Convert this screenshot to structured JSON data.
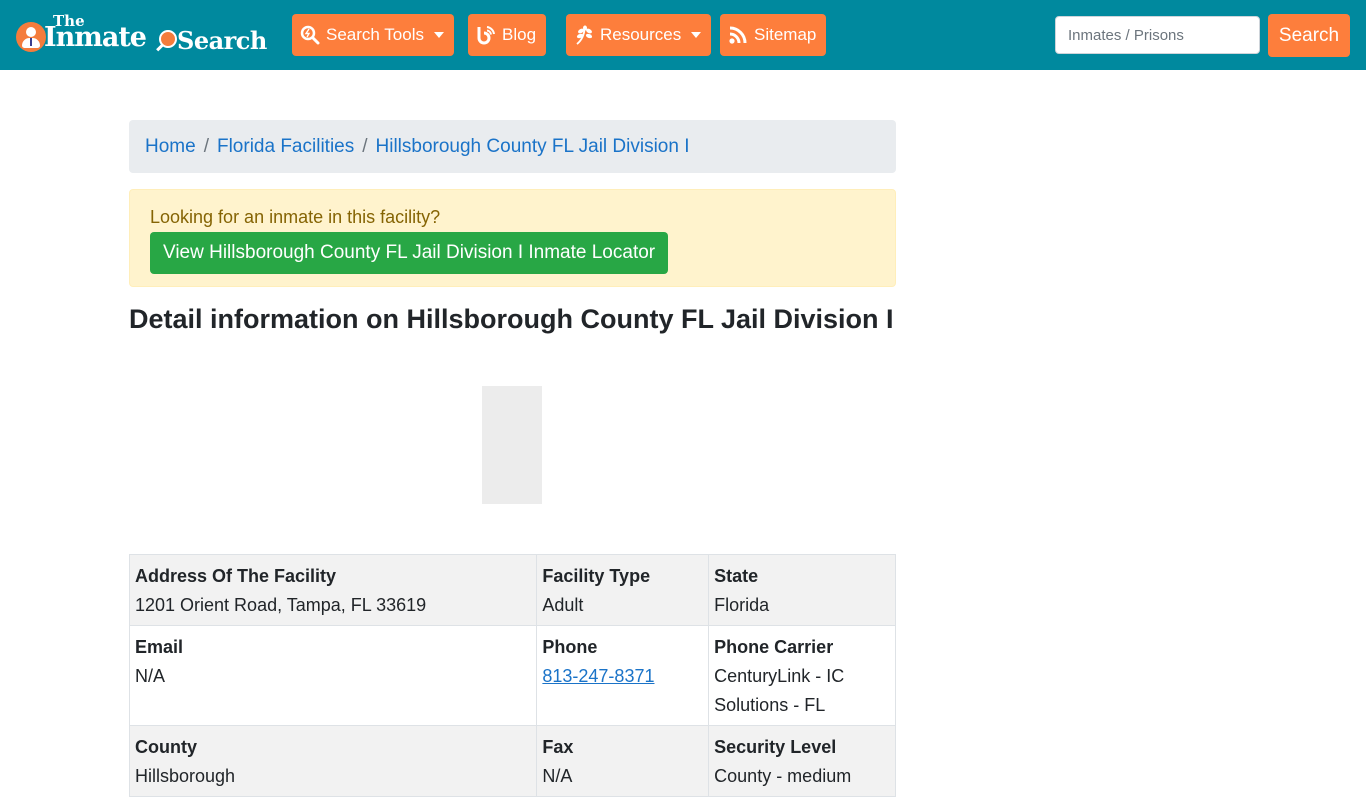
{
  "brand": {
    "line1": "The",
    "line2a": "Inmate",
    "line2b": "Search"
  },
  "nav": {
    "items": [
      {
        "label": "Search Tools",
        "icon": "search-icon",
        "dropdown": true
      },
      {
        "label": "Blog",
        "icon": "blog-icon",
        "dropdown": false
      },
      {
        "label": "Resources",
        "icon": "leaf-icon",
        "dropdown": true
      },
      {
        "label": "Sitemap",
        "icon": "rss-icon",
        "dropdown": false
      }
    ],
    "search_placeholder": "Inmates / Prisons",
    "search_button": "Search"
  },
  "breadcrumb": {
    "items": [
      "Home",
      "Florida Facilities",
      "Hillsborough County FL Jail Division I"
    ],
    "separator": "/"
  },
  "alert": {
    "question": "Looking for an inmate in this facility?",
    "button": "View Hillsborough County FL Jail Division I Inmate Locator"
  },
  "heading": "Detail information on Hillsborough County FL Jail Division I",
  "details": {
    "rows": [
      [
        {
          "label": "Address Of The Facility",
          "value": "1201 Orient Road, Tampa, FL 33619"
        },
        {
          "label": "Facility Type",
          "value": "Adult"
        },
        {
          "label": "State",
          "value": "Florida"
        }
      ],
      [
        {
          "label": "Email",
          "value": "N/A"
        },
        {
          "label": "Phone",
          "value": "813-247-8371"
        },
        {
          "label": "Phone Carrier",
          "value": "CenturyLink - IC Solutions - FL"
        }
      ],
      [
        {
          "label": "County",
          "value": "Hillsborough"
        },
        {
          "label": "Fax",
          "value": "N/A"
        },
        {
          "label": "Security Level",
          "value": "County - medium"
        }
      ]
    ]
  },
  "colors": {
    "navbar": "#00899e",
    "accent": "#fd7e3c",
    "success": "#28a745",
    "link": "#1a73c8"
  }
}
